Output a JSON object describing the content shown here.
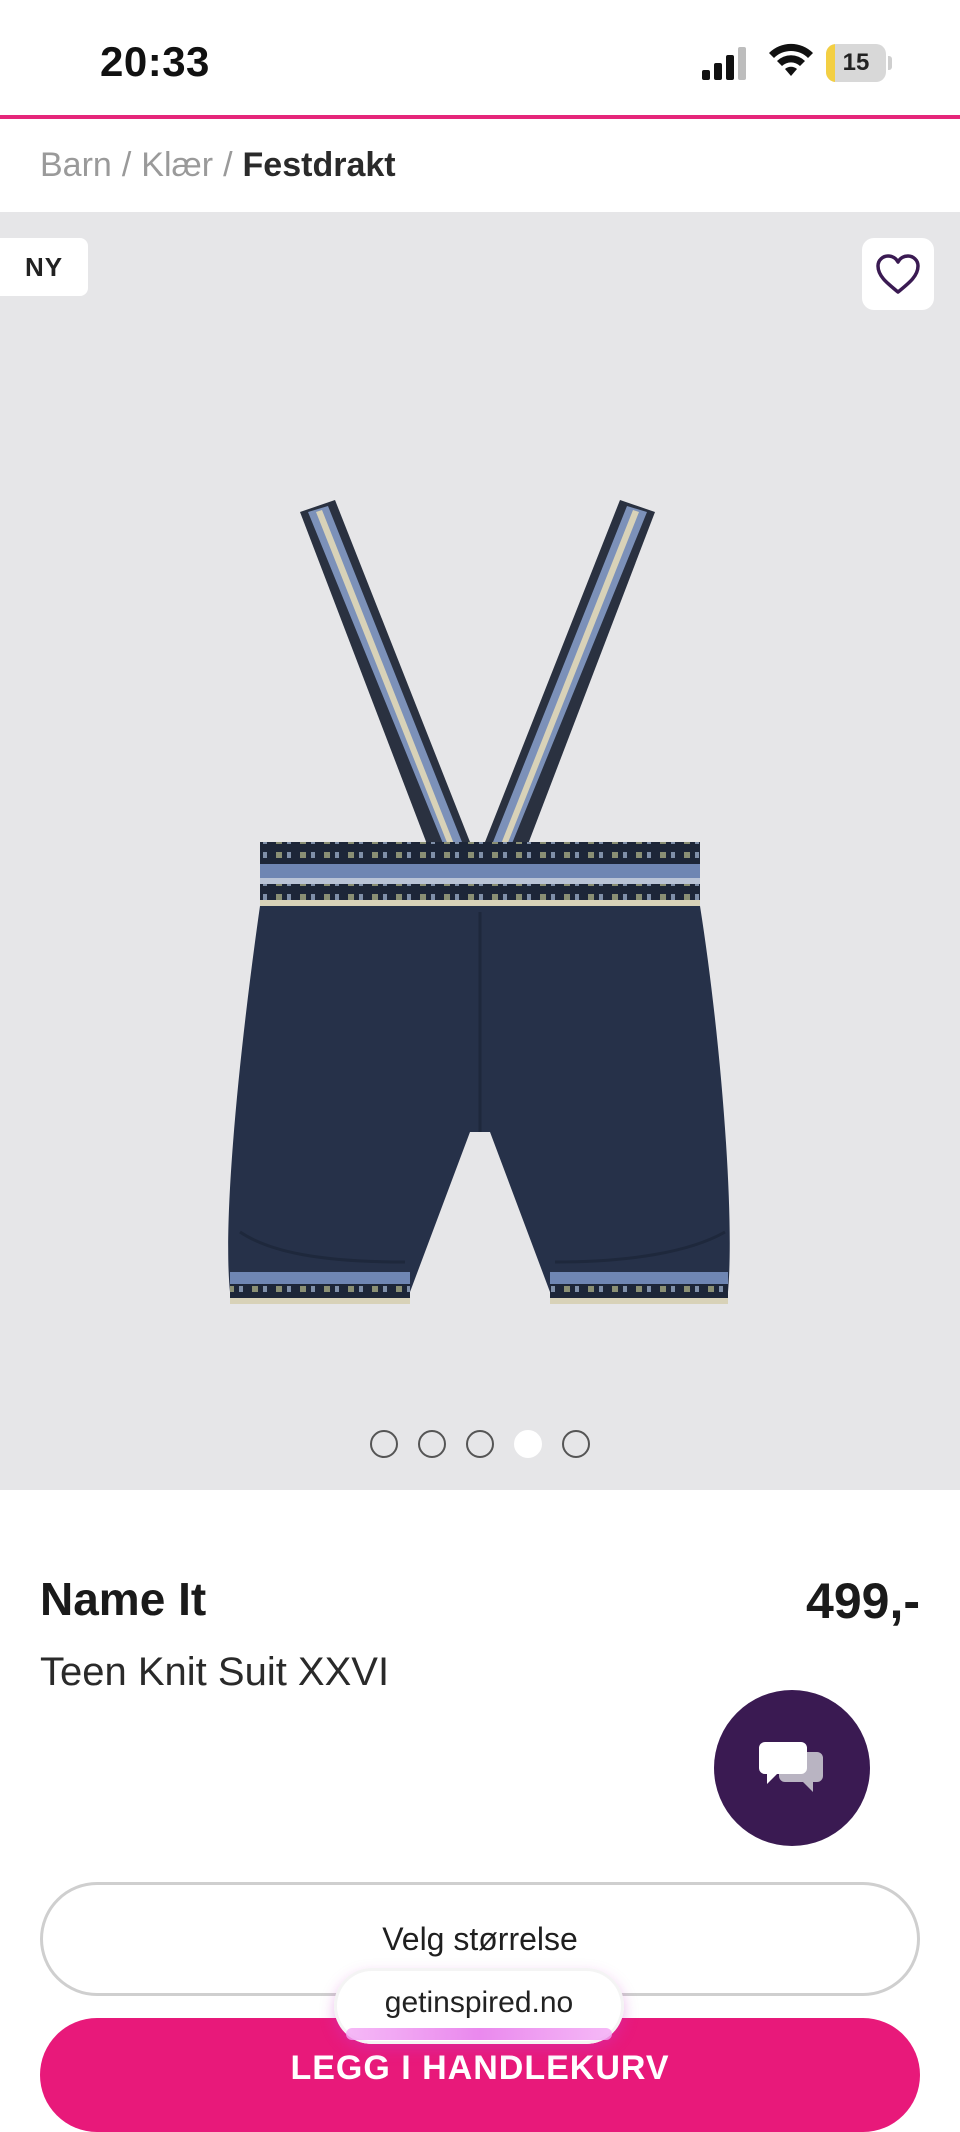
{
  "status_bar": {
    "time": "20:33",
    "battery_level": "15",
    "battery_fraction": 0.15
  },
  "breadcrumb": {
    "items": [
      "Barn",
      "Klær"
    ],
    "current": "Festdrakt",
    "separator": "/"
  },
  "product": {
    "badge": "NY",
    "brand": "Name It",
    "name": "Teen Knit Suit XXVI",
    "price": "499,-",
    "image_count": 5,
    "active_image_index": 3
  },
  "actions": {
    "size_select_label": "Velg størrelse",
    "add_to_cart_label": "LEGG I HANDLEKURV"
  },
  "browser": {
    "url": "getinspired.no"
  },
  "icons": {
    "favorite": "heart-outline-icon",
    "chat": "chat-bubbles-icon"
  },
  "colors": {
    "accent": "#e5267a",
    "cart_button": "#e8197a",
    "chat_fab": "#3a1a52",
    "hero_bg": "#e6e6e8"
  }
}
